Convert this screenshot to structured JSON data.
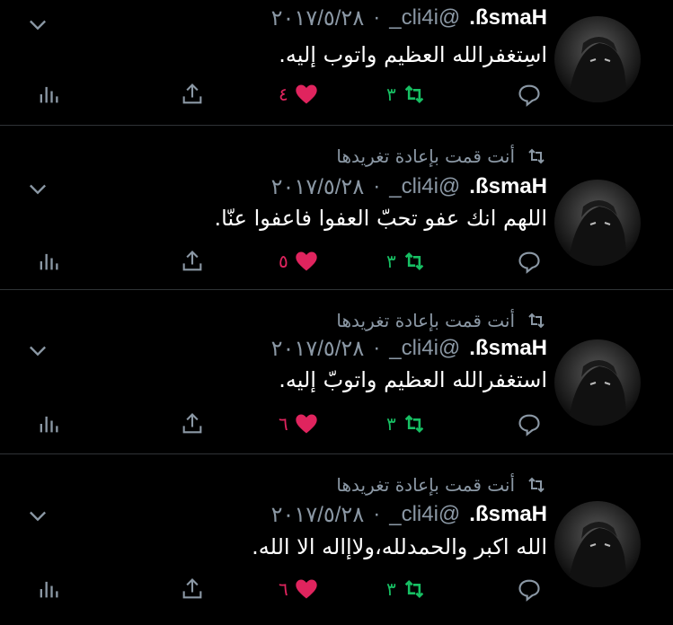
{
  "tweets": [
    {
      "retweet_context": null,
      "name": "ßsmaH.",
      "handle": "@cli4i_",
      "date": "٢٠١٧/٥/٢٨",
      "text": "اسِتغفرالله العظيم واتوب إليه.",
      "replies": "",
      "retweets": "٣",
      "likes": "٤",
      "retweeted": true,
      "liked": true
    },
    {
      "retweet_context": "أنت قمت بإعادة تغريدها",
      "name": "ßsmaH.",
      "handle": "@cli4i_",
      "date": "٢٠١٧/٥/٢٨",
      "text": "اللهم انك عفو تحبّ العفوا فاعفوا عنّا.",
      "replies": "",
      "retweets": "٣",
      "likes": "٥",
      "retweeted": true,
      "liked": true
    },
    {
      "retweet_context": "أنت قمت بإعادة تغريدها",
      "name": "ßsmaH.",
      "handle": "@cli4i_",
      "date": "٢٠١٧/٥/٢٨",
      "text": "استغفرالله العظيم واتوبّ إليه.",
      "replies": "",
      "retweets": "٣",
      "likes": "٦",
      "retweeted": true,
      "liked": true
    },
    {
      "retweet_context": "أنت قمت بإعادة تغريدها",
      "name": "ßsmaH.",
      "handle": "@cli4i_",
      "date": "٢٠١٧/٥/٢٨",
      "text": "الله اكبر والحمدلله،ولاإاله الا الله.",
      "replies": "",
      "retweets": "٣",
      "likes": "٦",
      "retweeted": true,
      "liked": true
    }
  ],
  "separator": "·",
  "colors": {
    "background": "#000000",
    "secondary_text": "#8b98a5",
    "retweet_green": "#17bf63",
    "like_red": "#e0245e",
    "icon_gray": "#8b98a5"
  },
  "icons": {
    "reply": "reply-icon",
    "retweet": "retweet-icon",
    "like": "heart-icon",
    "share": "share-icon",
    "analytics": "analytics-icon",
    "more": "chevron-down-icon"
  }
}
